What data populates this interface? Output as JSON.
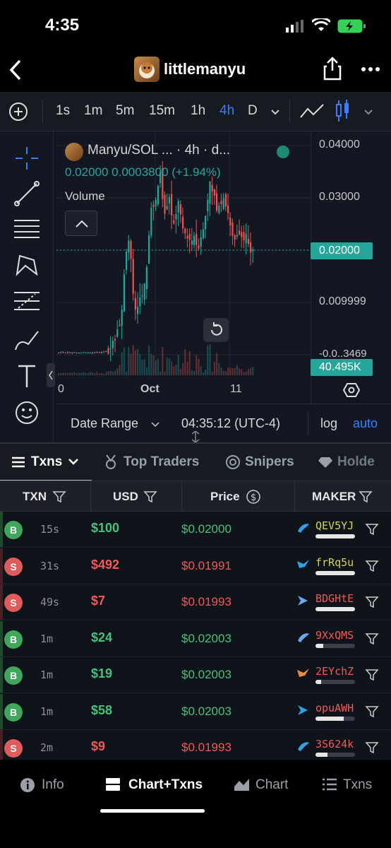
{
  "status": {
    "time": "4:35"
  },
  "nav": {
    "title": "littlemanyu"
  },
  "timeframes": [
    {
      "label": "1s",
      "active": false
    },
    {
      "label": "1m",
      "active": false
    },
    {
      "label": "5m",
      "active": false
    },
    {
      "label": "15m",
      "active": false
    },
    {
      "label": "1h",
      "active": false
    },
    {
      "label": "4h",
      "active": true
    },
    {
      "label": "D",
      "active": false
    }
  ],
  "chart": {
    "legend_title": "Manyu/SOL ... · 4h · d...",
    "legend_values": "0.02000  0.0003800 (+1.94%)",
    "volume_label": "Volume",
    "price_tag": "0.02000",
    "volume_tag": "40.495K",
    "date_range": "Date Range",
    "clock": "04:35:12 (UTC-4)",
    "log": "log",
    "auto": "auto",
    "colors": {
      "up": "#26a69a",
      "down": "#ef5350",
      "price_tag": "#26a69a"
    }
  },
  "chart_data": {
    "type": "candlestick",
    "ytick_labels": [
      "0.04000",
      "0.03000",
      "0.009999",
      "-0.0..3469"
    ],
    "xtick_labels": [
      "0",
      "Oct",
      "11"
    ],
    "last_price": 0.02,
    "volume_last": "40.495K"
  },
  "tabs": [
    {
      "label": "Txns",
      "active": true
    },
    {
      "label": "Top Traders",
      "active": false
    },
    {
      "label": "Snipers",
      "active": false
    },
    {
      "label": "Holde",
      "active": false
    }
  ],
  "table": {
    "headers": [
      "TXN",
      "USD",
      "Price",
      "MAKER"
    ],
    "rows": [
      {
        "side": "B",
        "age": "15s",
        "usd": "$100",
        "price": "$0.02000",
        "maker": "QEV5YJ",
        "maker_color": "#d6d45a",
        "level": 1.0,
        "icon_color": "#2f9fe6"
      },
      {
        "side": "S",
        "age": "31s",
        "usd": "$492",
        "price": "$0.01991",
        "maker": "frRq5u",
        "maker_color": "#d6d45a",
        "level": 1.0,
        "icon_color": "#2f9fe6"
      },
      {
        "side": "S",
        "age": "49s",
        "usd": "$7",
        "price": "$0.01993",
        "maker": "BDGHtE",
        "maker_color": "#ef5a5a",
        "level": 1.0,
        "icon_color": "#6aa8f0"
      },
      {
        "side": "B",
        "age": "1m",
        "usd": "$24",
        "price": "$0.02003",
        "maker": "9XxQMS",
        "maker_color": "#ef5a5a",
        "level": 0.2,
        "icon_color": "#6aa8f0"
      },
      {
        "side": "B",
        "age": "1m",
        "usd": "$19",
        "price": "$0.02003",
        "maker": "2EYchZ",
        "maker_color": "#ef5a5a",
        "level": 0.15,
        "icon_color": "#f08a3a"
      },
      {
        "side": "B",
        "age": "1m",
        "usd": "$58",
        "price": "$0.02003",
        "maker": "opuAWH",
        "maker_color": "#ef5a5a",
        "level": 0.72,
        "icon_color": "#2f9fe6"
      },
      {
        "side": "S",
        "age": "2m",
        "usd": "$9",
        "price": "$0.01993",
        "maker": "3S624k",
        "maker_color": "#ef5a5a",
        "level": 0.3,
        "icon_color": "#2f9fe6"
      }
    ]
  },
  "bottom_nav": [
    {
      "label": "Info",
      "active": false
    },
    {
      "label": "Chart+Txns",
      "active": true
    },
    {
      "label": "Chart",
      "active": false
    },
    {
      "label": "Txns",
      "active": false
    }
  ]
}
